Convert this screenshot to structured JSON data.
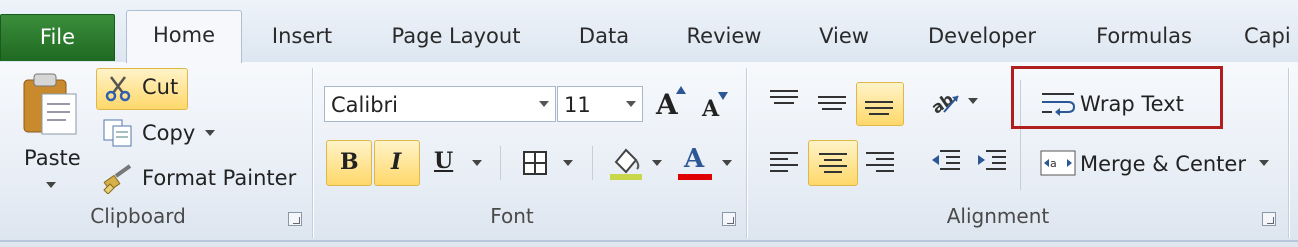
{
  "tabs": [
    "File",
    "Home",
    "Insert",
    "Page Layout",
    "Data",
    "Review",
    "View",
    "Developer",
    "Formulas",
    "Capi"
  ],
  "clipboard": {
    "paste": "Paste",
    "cut": "Cut",
    "copy": "Copy",
    "format_painter": "Format Painter",
    "group": "Clipboard"
  },
  "font": {
    "name": "Calibri",
    "size": "11",
    "group": "Font",
    "bold": "B",
    "italic": "I",
    "underline": "U",
    "grow": "A",
    "shrink": "A",
    "color_letter": "A"
  },
  "alignment": {
    "wrap_text": "Wrap Text",
    "merge_center": "Merge & Center",
    "group": "Alignment"
  },
  "colors": {
    "file_tab": "#2e7d32",
    "highlight": "#ffd86a",
    "callout": "#b01e1e",
    "fill_color": "#c8d84a",
    "font_color": "#e00000"
  }
}
